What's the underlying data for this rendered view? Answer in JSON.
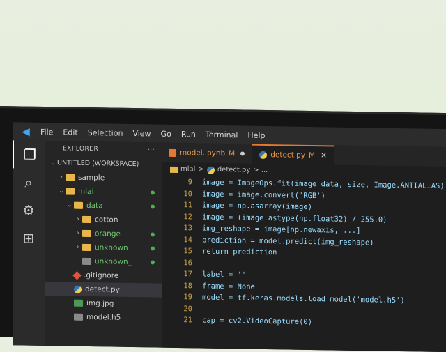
{
  "menu": {
    "items": [
      "File",
      "Edit",
      "Selection",
      "View",
      "Go",
      "Run",
      "Terminal",
      "Help"
    ]
  },
  "activity": {
    "icons": [
      "files-icon",
      "search-icon",
      "run-debug-icon",
      "extensions-icon"
    ]
  },
  "explorer": {
    "header": "EXPLORER",
    "header_more": "···",
    "workspace": "UNTITLED (WORKSPACE)",
    "tree": [
      {
        "label": "sample",
        "type": "folder",
        "indent": 1,
        "chev": "›",
        "dot": false
      },
      {
        "label": "mlai",
        "type": "folder",
        "indent": 1,
        "chev": "⌄",
        "dot": true,
        "green": true
      },
      {
        "label": "data",
        "type": "folder",
        "indent": 2,
        "chev": "⌄",
        "dot": true,
        "green": true
      },
      {
        "label": "cotton",
        "type": "folder",
        "indent": 3,
        "chev": "›",
        "dot": false
      },
      {
        "label": "orange",
        "type": "folder",
        "indent": 3,
        "chev": "›",
        "dot": true,
        "green": true
      },
      {
        "label": "unknown",
        "type": "folder",
        "indent": 3,
        "chev": "›",
        "dot": true,
        "green": true
      },
      {
        "label": "unknown_",
        "type": "file",
        "indent": 3,
        "chev": "",
        "dot": true,
        "green": true
      },
      {
        "label": ".gitignore",
        "type": "git",
        "indent": 2,
        "chev": "",
        "dot": false
      },
      {
        "label": "detect.py",
        "type": "py",
        "indent": 2,
        "chev": "",
        "dot": false,
        "selected": true
      },
      {
        "label": "img.jpg",
        "type": "img",
        "indent": 2,
        "chev": "",
        "dot": false
      },
      {
        "label": "model.h5",
        "type": "file",
        "indent": 2,
        "chev": "",
        "dot": false
      }
    ]
  },
  "tabs": [
    {
      "label": "model.ipynb",
      "state": "M",
      "active": false
    },
    {
      "label": "detect.py",
      "state": "M",
      "active": true
    }
  ],
  "breadcrumb": {
    "folder": "mlai",
    "sep": ">",
    "file": "detect.py",
    "trail": "> ..."
  },
  "code": [
    {
      "n": "9",
      "t": "image = ImageOps.fit(image_data, size, Image.ANTIALIAS)"
    },
    {
      "n": "10",
      "t": "image = image.convert('RGB')"
    },
    {
      "n": "11",
      "t": "image = np.asarray(image)"
    },
    {
      "n": "12",
      "t": "image = (image.astype(np.float32) / 255.0)"
    },
    {
      "n": "13",
      "t": "img_reshape = image[np.newaxis, ...]"
    },
    {
      "n": "14",
      "t": "prediction = model.predict(img_reshape)"
    },
    {
      "n": "15",
      "t": "return prediction"
    },
    {
      "n": "16",
      "t": ""
    },
    {
      "n": "17",
      "t": "label = ''"
    },
    {
      "n": "18",
      "t": "frame = None"
    },
    {
      "n": "19",
      "t": "model = tf.keras.models.load_model('model.h5')"
    },
    {
      "n": "20",
      "t": ""
    },
    {
      "n": "21",
      "t": "cap = cv2.VideoCapture(0)"
    }
  ],
  "colors": {
    "accent": "#e37933",
    "vscode_blue": "#3fa7f2",
    "git_green": "#4caf50"
  }
}
